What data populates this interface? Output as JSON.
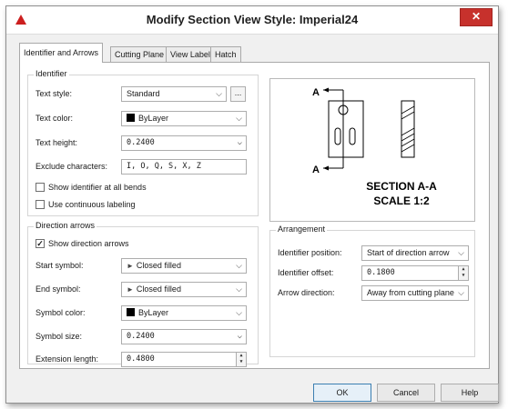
{
  "window": {
    "title": "Modify Section View Style: Imperial24",
    "close_glyph": "✕"
  },
  "tabs": [
    {
      "label": "Identifier and Arrows"
    },
    {
      "label": "Cutting Plane"
    },
    {
      "label": "View Label"
    },
    {
      "label": "Hatch"
    }
  ],
  "identifier": {
    "title": "Identifier",
    "text_style_label": "Text style:",
    "text_style_value": "Standard",
    "browse_label": "...",
    "text_color_label": "Text color:",
    "text_color_value": "ByLayer",
    "text_height_label": "Text height:",
    "text_height_value": "0.2400",
    "exclude_label": "Exclude characters:",
    "exclude_value": "I, O, Q, S, X, Z",
    "show_at_bends_label": "Show identifier at all bends",
    "show_at_bends_checked": false,
    "continuous_label": "Use continuous labeling",
    "continuous_checked": false
  },
  "direction_arrows": {
    "title": "Direction arrows",
    "show_label": "Show direction arrows",
    "show_checked": true,
    "start_symbol_label": "Start symbol:",
    "start_symbol_value": "Closed filled",
    "end_symbol_label": "End symbol:",
    "end_symbol_value": "Closed filled",
    "symbol_color_label": "Symbol color:",
    "symbol_color_value": "ByLayer",
    "symbol_size_label": "Symbol size:",
    "symbol_size_value": "0.2400",
    "extension_label": "Extension length:",
    "extension_value": "0.4800"
  },
  "preview": {
    "id_top": "A",
    "id_bottom": "A",
    "caption_line1": "SECTION A-A",
    "caption_line2": "SCALE 1:2"
  },
  "arrangement": {
    "title": "Arrangement",
    "position_label": "Identifier position:",
    "position_value": "Start of direction arrow",
    "offset_label": "Identifier offset:",
    "offset_value": "0.1800",
    "direction_label": "Arrow direction:",
    "direction_value": "Away from cutting plane"
  },
  "buttons": {
    "ok": "OK",
    "cancel": "Cancel",
    "help": "Help"
  },
  "colors": {
    "close_red": "#c7312c",
    "accent_blue": "#3c7fb1",
    "app_icon_red": "#cc1f1f"
  }
}
